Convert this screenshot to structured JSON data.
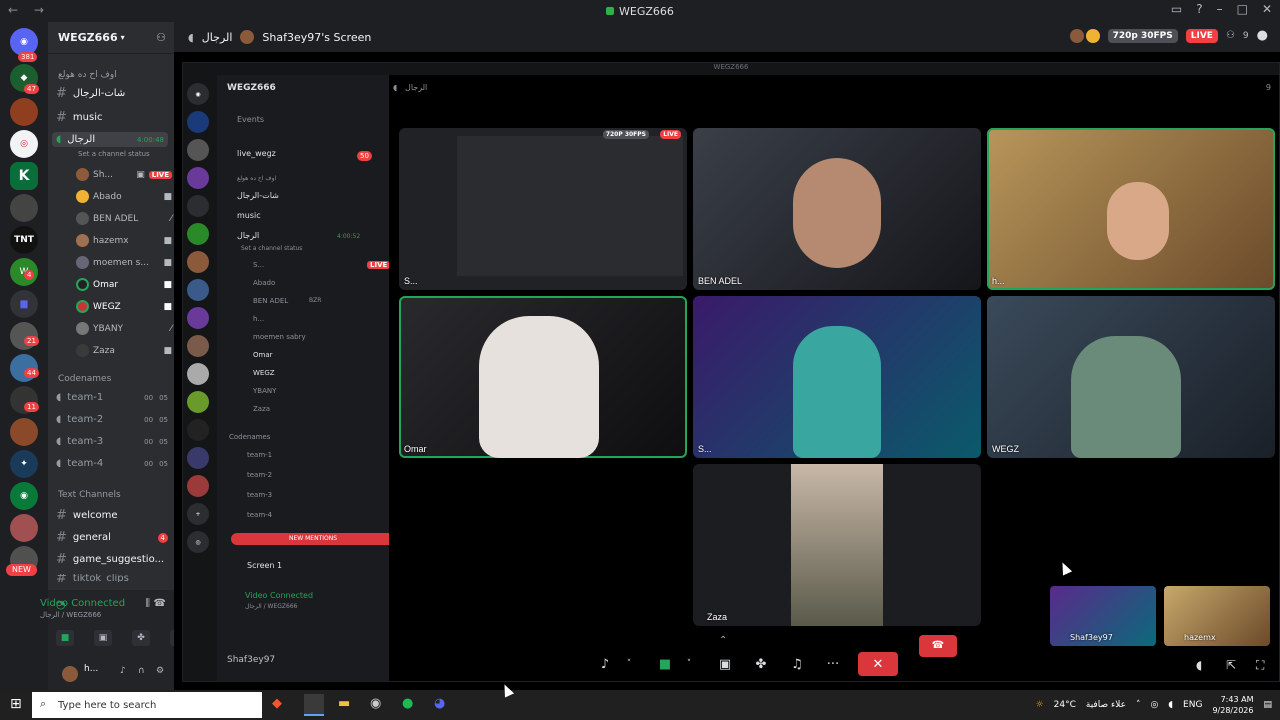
{
  "window": {
    "title": "WEGZ666"
  },
  "guild_badges": [
    "381",
    "47",
    "4",
    "21",
    "44",
    "11",
    "NEW"
  ],
  "guild_labels": [
    "TNT"
  ],
  "sidebar": {
    "server_name": "WEGZ666",
    "category_top": "اوف اح ده هولع",
    "channels": [
      {
        "name": "شات-الرجال"
      },
      {
        "name": "music"
      }
    ],
    "voice": {
      "name": "الرجال",
      "timer": "4:00:48",
      "status": "Set a channel status"
    },
    "members": [
      {
        "name": "Sh...",
        "live": "LIVE"
      },
      {
        "name": "Abado"
      },
      {
        "name": "BEN ADEL"
      },
      {
        "name": "hazemx"
      },
      {
        "name": "moemen s..."
      },
      {
        "name": "Omar"
      },
      {
        "name": "WEGZ"
      },
      {
        "name": "YBANY"
      },
      {
        "name": "Zaza"
      }
    ],
    "codenames_label": "Codenames",
    "teams": [
      {
        "name": "team-1",
        "a": "00",
        "b": "05"
      },
      {
        "name": "team-2",
        "a": "00",
        "b": "05"
      },
      {
        "name": "team-3",
        "a": "00",
        "b": "05"
      },
      {
        "name": "team-4",
        "a": "00",
        "b": "05"
      }
    ],
    "text_label": "Text Channels",
    "text_channels": [
      {
        "name": "welcome"
      },
      {
        "name": "general",
        "badge": "4"
      },
      {
        "name": "game_suggestio..."
      },
      {
        "name": "tiktok_clips"
      }
    ],
    "vc": {
      "title": "Video Connected",
      "sub": "الرجال / WEGZ666"
    },
    "user": {
      "name": "h..."
    }
  },
  "main_header": {
    "channel": "الرجال",
    "screen": "Shaf3ey97's Screen",
    "quality": "720p 30FPS",
    "live": "LIVE",
    "viewers": "9"
  },
  "inner": {
    "title": "WEGZ666",
    "server_name": "WEGZ666",
    "events": "Events",
    "live_channel": "live_wegz",
    "live_badge": "50",
    "cat": "اوف اح ده هولع",
    "channels": [
      "شات-الرجال",
      "music",
      "الرجال"
    ],
    "timer": "4:00:52",
    "status": "Set a channel status",
    "members": [
      "S...",
      "Abado",
      "BEN ADEL",
      "h...",
      "moemen sabry",
      "Omar",
      "WEGZ",
      "YBANY",
      "Zaza"
    ],
    "member_live": "LIVE",
    "ben_tag": "BZR",
    "codenames": "Codenames",
    "teams": [
      "team-1",
      "team-2",
      "team-3",
      "team-4"
    ],
    "new_mentions": "NEW MENTIONS",
    "screen_label": "Screen 1",
    "vc_title": "Video Connected",
    "vc_sub": "الرجال / WEGZ666",
    "user": "Shaf3ey97",
    "stage_header": "الرجال",
    "stage_viewers": "9",
    "stream_quality": "720P 30FPS",
    "stream_live": "LIVE"
  },
  "tiles": [
    {
      "name": "S..."
    },
    {
      "name": "BEN ADEL"
    },
    {
      "name": "h..."
    },
    {
      "name": "Omar"
    },
    {
      "name": "S..."
    },
    {
      "name": "WEGZ"
    },
    {
      "name": "Zaza"
    }
  ],
  "thumbs": [
    {
      "name": "Shaf3ey97"
    },
    {
      "name": "hazemx"
    }
  ],
  "taskbar": {
    "search_placeholder": "Type here to search",
    "weather": "24°C",
    "weather_text": "علاء صافية",
    "lang": "ENG",
    "time": "7:43 AM",
    "date": "9/28/2026"
  }
}
